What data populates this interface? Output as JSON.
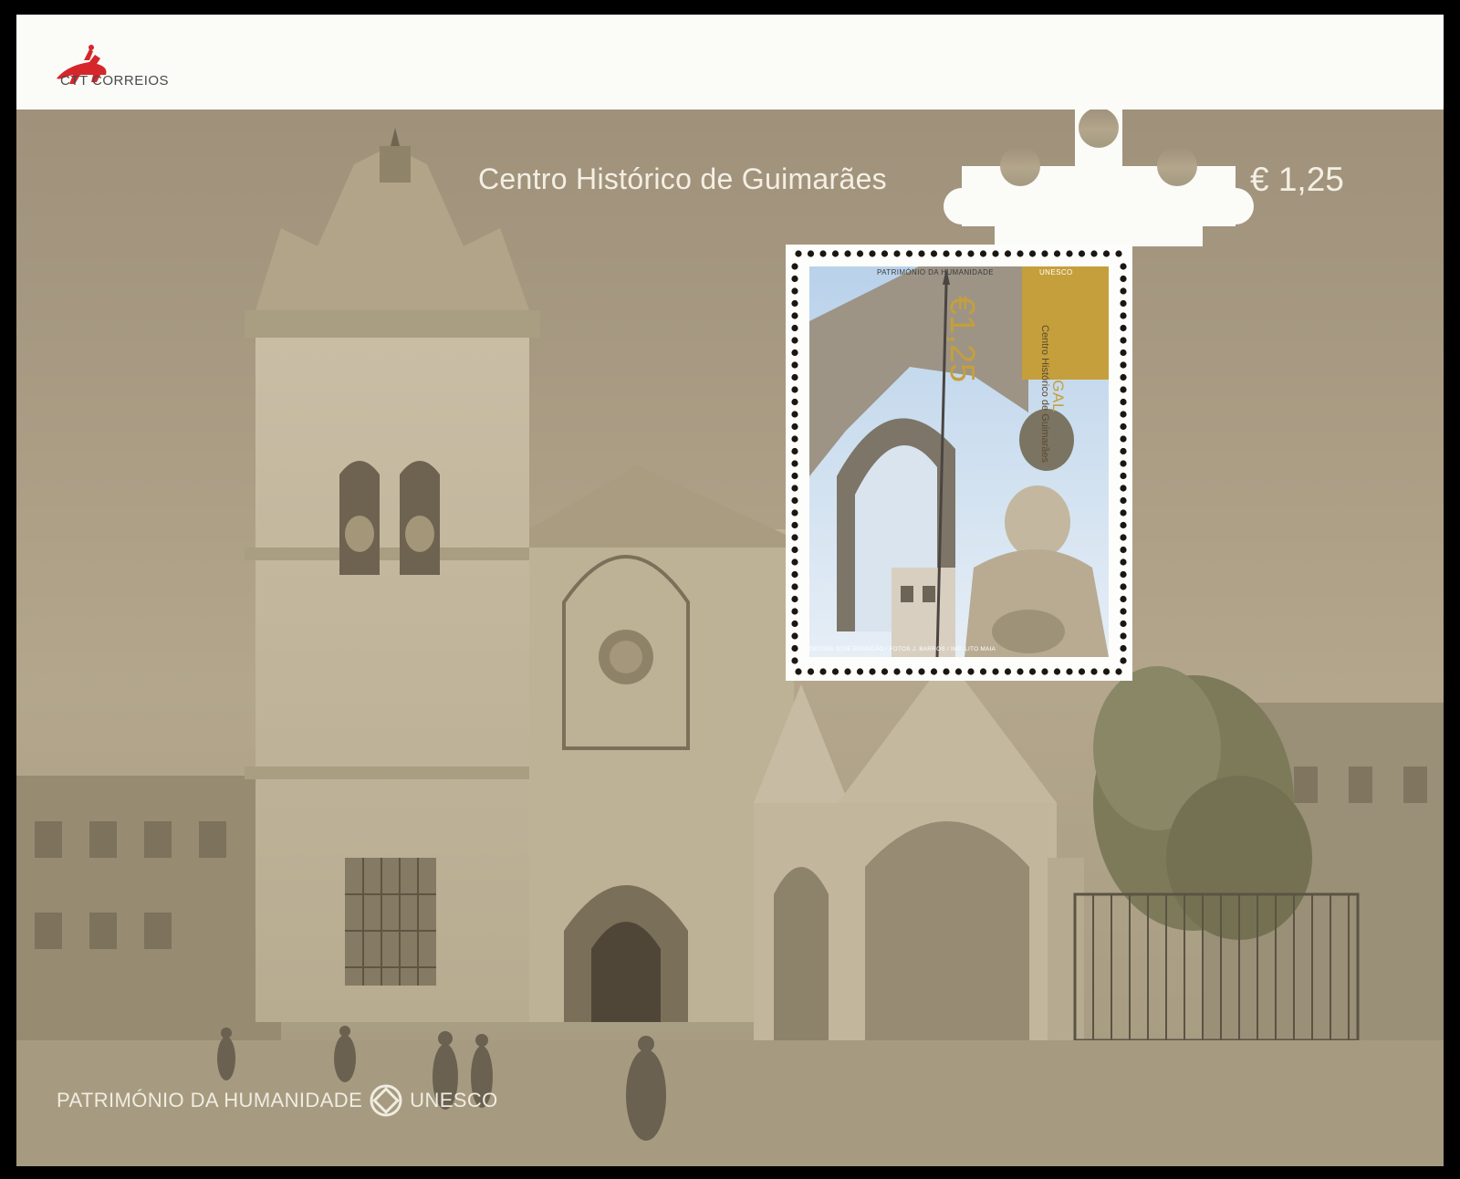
{
  "sheet": {
    "publisher": "CTT CORREIOS",
    "title": "Centro Histórico de Guimarães",
    "value": "€ 1,25",
    "legend": "PATRIMÓNIO DA HUMANIDADE",
    "legend_unesco": "UNESCO"
  },
  "stamp": {
    "upper_text": "PATRIMÓNIO DA HUMANIDADE",
    "unesco": "UNESCO",
    "value": "€1,25",
    "country": "PORTUGAL",
    "subject": "Centro Histórico de Guimarães",
    "credits": "DESIGN JOSÉ BRANDÃO / FOTOS J. BARROS / IMP. LITO MAIA"
  },
  "colors": {
    "sepia": "#a8997c",
    "gold": "#c59f3c",
    "paper": "#fbfbf8"
  }
}
